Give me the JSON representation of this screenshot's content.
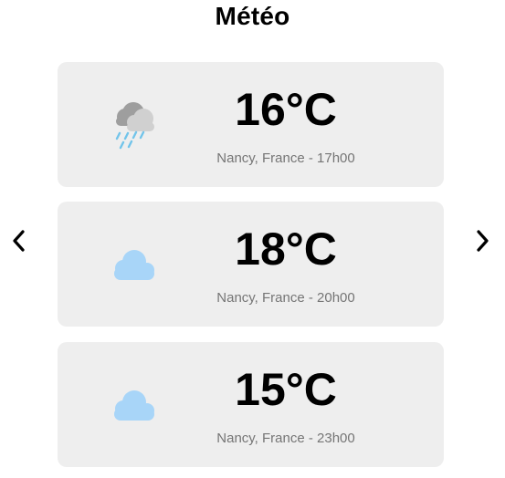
{
  "page": {
    "title": "Météo"
  },
  "nav": {
    "prev_icon": "chevron-left-icon",
    "next_icon": "chevron-right-icon"
  },
  "colors": {
    "card_background": "#eeeeee",
    "cloud_light_blue": "#a8d5f8",
    "rain_cloud_gray": "#c9c9c9",
    "rain_drop": "#72c4ea",
    "subtext": "#757575"
  },
  "forecasts": [
    {
      "temperature": "16°C",
      "location_time": "Nancy, France - 17h00",
      "icon": "rain-cloud-icon"
    },
    {
      "temperature": "18°C",
      "location_time": "Nancy, France - 20h00",
      "icon": "cloud-icon"
    },
    {
      "temperature": "15°C",
      "location_time": "Nancy, France - 23h00",
      "icon": "cloud-icon"
    }
  ]
}
